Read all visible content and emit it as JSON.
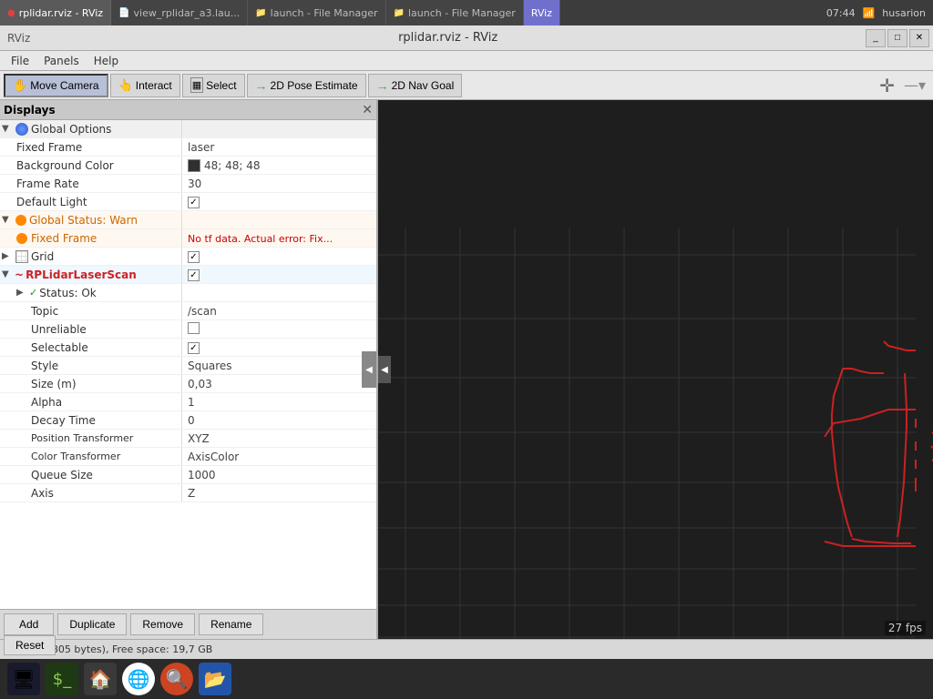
{
  "titlebar": {
    "tabs": [
      {
        "id": "rviz-tab",
        "label": "rplidar.rviz - RViz",
        "icon": "🔴",
        "active": true
      },
      {
        "id": "view-tab",
        "label": "view_rplidar_a3.lau...",
        "icon": "📄",
        "active": false
      },
      {
        "id": "launch-manager1",
        "label": "launch - File Manager",
        "icon": "📁",
        "active": false
      },
      {
        "id": "launch-manager2",
        "label": "launch - File Manager",
        "icon": "📁",
        "active": false
      },
      {
        "id": "rviz-btn",
        "label": "RViz",
        "active": false
      }
    ],
    "time": "07:44",
    "wifi": "husarion"
  },
  "app": {
    "title": "rplidar.rviz - RViz",
    "rviz_label": "RViz"
  },
  "menubar": {
    "items": [
      "File",
      "Panels",
      "Help"
    ]
  },
  "toolbar": {
    "move_camera": "Move Camera",
    "interact": "Interact",
    "select": "Select",
    "pose_estimate": "2D Pose Estimate",
    "nav_goal": "2D Nav Goal"
  },
  "displays": {
    "title": "Displays",
    "global_options": {
      "label": "Global Options",
      "fixed_frame_label": "Fixed Frame",
      "fixed_frame_value": "laser",
      "background_color_label": "Background Color",
      "background_color_value": "48; 48; 48",
      "frame_rate_label": "Frame Rate",
      "frame_rate_value": "30",
      "default_light_label": "Default Light",
      "default_light_checked": true
    },
    "global_status": {
      "label": "Global Status: Warn",
      "fixed_frame_label": "Fixed Frame",
      "fixed_frame_error": "No tf data.  Actual error: Fix..."
    },
    "grid": {
      "label": "Grid",
      "checked": true
    },
    "rplidar": {
      "label": "RPLidarLaserScan",
      "status_label": "Status: Ok",
      "topic_label": "Topic",
      "topic_value": "/scan",
      "unreliable_label": "Unreliable",
      "unreliable_checked": false,
      "selectable_label": "Selectable",
      "selectable_checked": true,
      "style_label": "Style",
      "style_value": "Squares",
      "size_label": "Size (m)",
      "size_value": "0,03",
      "alpha_label": "Alpha",
      "alpha_value": "1",
      "decay_label": "Decay Time",
      "decay_value": "0",
      "position_transformer_label": "Position Transformer",
      "position_transformer_value": "XYZ",
      "color_transformer_label": "Color Transformer",
      "color_transformer_value": "AxisColor",
      "queue_size_label": "Queue Size",
      "queue_size_value": "1000",
      "axis_label": "Axis",
      "axis_value": "Z"
    }
  },
  "buttons": {
    "add": "Add",
    "duplicate": "Duplicate",
    "remove": "Remove",
    "rename": "Rename",
    "reset": "Reset"
  },
  "statusbar": {
    "text": "4 items (805 bytes), Free space: 19,7 GB"
  },
  "viewport": {
    "fps": "27 fps"
  },
  "taskbar": {
    "icons": [
      {
        "id": "monitor",
        "label": "Monitor"
      },
      {
        "id": "terminal",
        "label": "Terminal"
      },
      {
        "id": "home",
        "label": "Home"
      },
      {
        "id": "chrome",
        "label": "Chrome"
      },
      {
        "id": "magnifier",
        "label": "Magnifier"
      },
      {
        "id": "files",
        "label": "Files"
      }
    ]
  }
}
